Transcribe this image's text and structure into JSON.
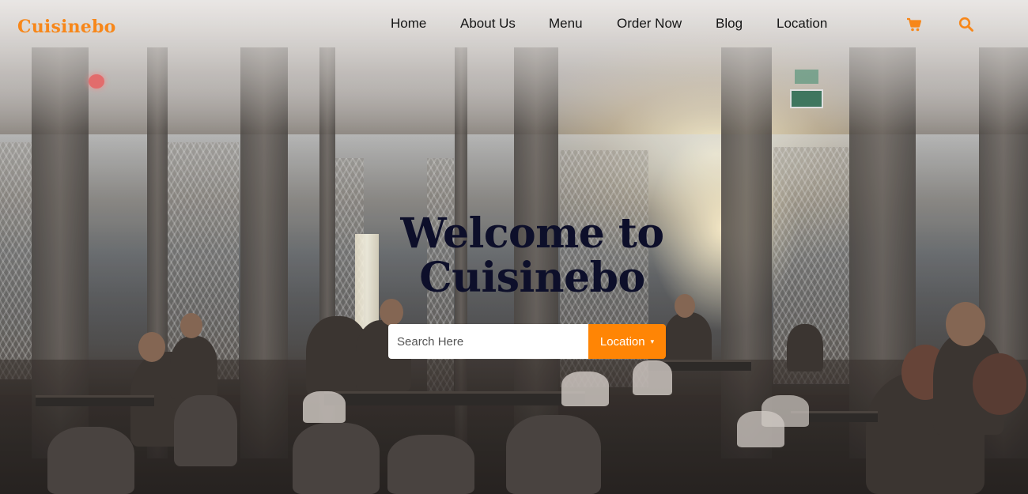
{
  "brand": {
    "name": "Cuisinebo",
    "color": "#f7871a"
  },
  "nav": {
    "items": [
      {
        "label": "Home"
      },
      {
        "label": "About Us"
      },
      {
        "label": "Menu"
      },
      {
        "label": "Order Now"
      },
      {
        "label": "Blog"
      },
      {
        "label": "Location"
      }
    ],
    "icons": [
      "cart-icon",
      "search-icon"
    ],
    "icon_color": "#f7871a"
  },
  "hero": {
    "title": "Welcome to Cuisinebo",
    "search": {
      "placeholder": "Search Here",
      "value": ""
    },
    "location_button": {
      "label": "Location",
      "caret": "▾",
      "color": "#ff8505"
    }
  }
}
